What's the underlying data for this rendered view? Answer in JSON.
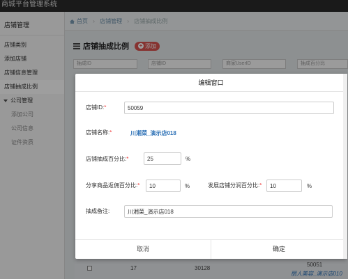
{
  "topbar": {
    "title": "商城平台管理系统"
  },
  "sidebar": {
    "header": "店铺管理",
    "items": [
      {
        "label": "店铺类别"
      },
      {
        "label": "添加店铺"
      },
      {
        "label": "店铺信息管理"
      },
      {
        "label": "店铺抽成比例",
        "active": true
      }
    ],
    "group": {
      "label": "公司管理",
      "items": [
        {
          "label": "添加公司"
        },
        {
          "label": "公司信息"
        },
        {
          "label": "证件资质"
        }
      ]
    }
  },
  "breadcrumb": {
    "home": "首页",
    "section": "店铺管理",
    "current": "店铺抽成比例"
  },
  "page": {
    "title": "店铺抽成比例",
    "add_label": "添加",
    "filters": [
      "抽成ID",
      "店铺ID",
      "商家UserID",
      "抽成百分比"
    ]
  },
  "table_row": {
    "id": "17",
    "shop_id": "30128",
    "user_id": "50051",
    "shop_name": "丽人美容_演示店010"
  },
  "modal": {
    "title": "编辑窗口",
    "shop_id_label": "店铺ID:",
    "shop_id_value": "50059",
    "shop_name_label": "店铺名称:",
    "shop_name_value": "川湘菜_演示店018",
    "ratio_label": "店铺抽成百分比:",
    "ratio_value": "25",
    "share_label": "分享商品返佣百分比:",
    "share_value": "10",
    "develop_label": "发展店铺分润百分比:",
    "develop_value": "10",
    "note_label": "抽成备注:",
    "note_value": "川湘菜_演示店018",
    "percent": "%",
    "required_mark": "*",
    "cancel_label": "取消",
    "confirm_label": "确定"
  }
}
